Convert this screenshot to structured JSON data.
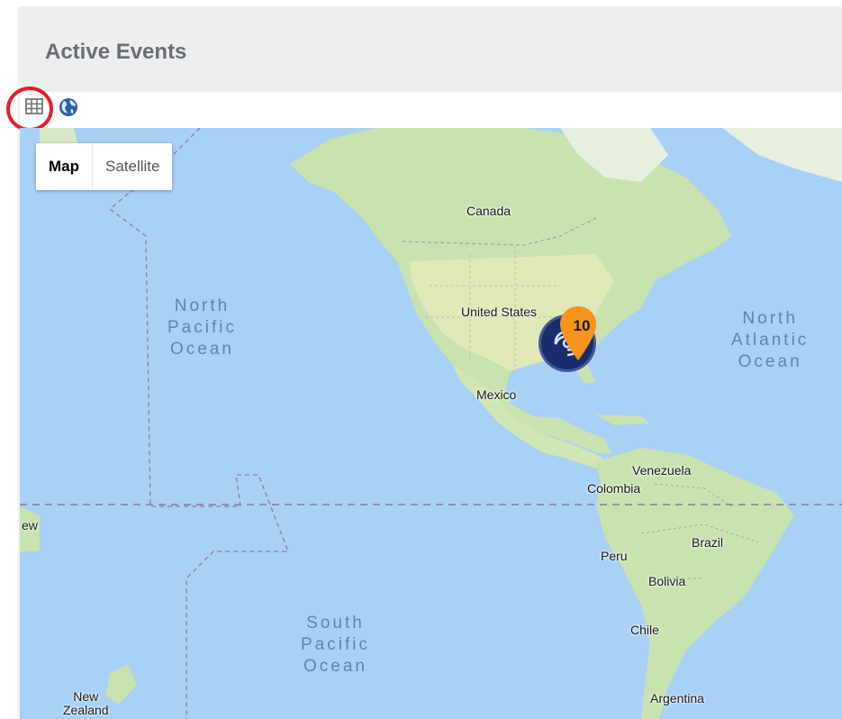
{
  "panel": {
    "title": "Active Events"
  },
  "toolbar": {
    "grid_view_icon": "grid-icon",
    "map_view_icon": "globe-icon"
  },
  "map_type_control": {
    "map_label": "Map",
    "satellite_label": "Satellite",
    "selected": "Map"
  },
  "map": {
    "labels": {
      "canada": "Canada",
      "united_states": "United States",
      "mexico": "Mexico",
      "venezuela": "Venezuela",
      "colombia": "Colombia",
      "brazil": "Brazil",
      "peru": "Peru",
      "bolivia": "Bolivia",
      "chile": "Chile",
      "argentina": "Argentina",
      "new_zealand": "New\nZealand",
      "cut_off_left": "ew"
    },
    "oceans": {
      "north_pacific": "North\nPacific\nOcean",
      "north_atlantic": "North\nAtlantic\nOcean",
      "south_pacific": "South\nPacific\nOcean"
    },
    "marker": {
      "count": "10",
      "cluster_icon": "hurricane-icon",
      "pin_color": "#f7941d",
      "cluster_color": "#1a2c6b"
    },
    "colors": {
      "water": "#a9d0f5",
      "land": "#c8e2b0",
      "highlight": "#e51d2b"
    }
  }
}
